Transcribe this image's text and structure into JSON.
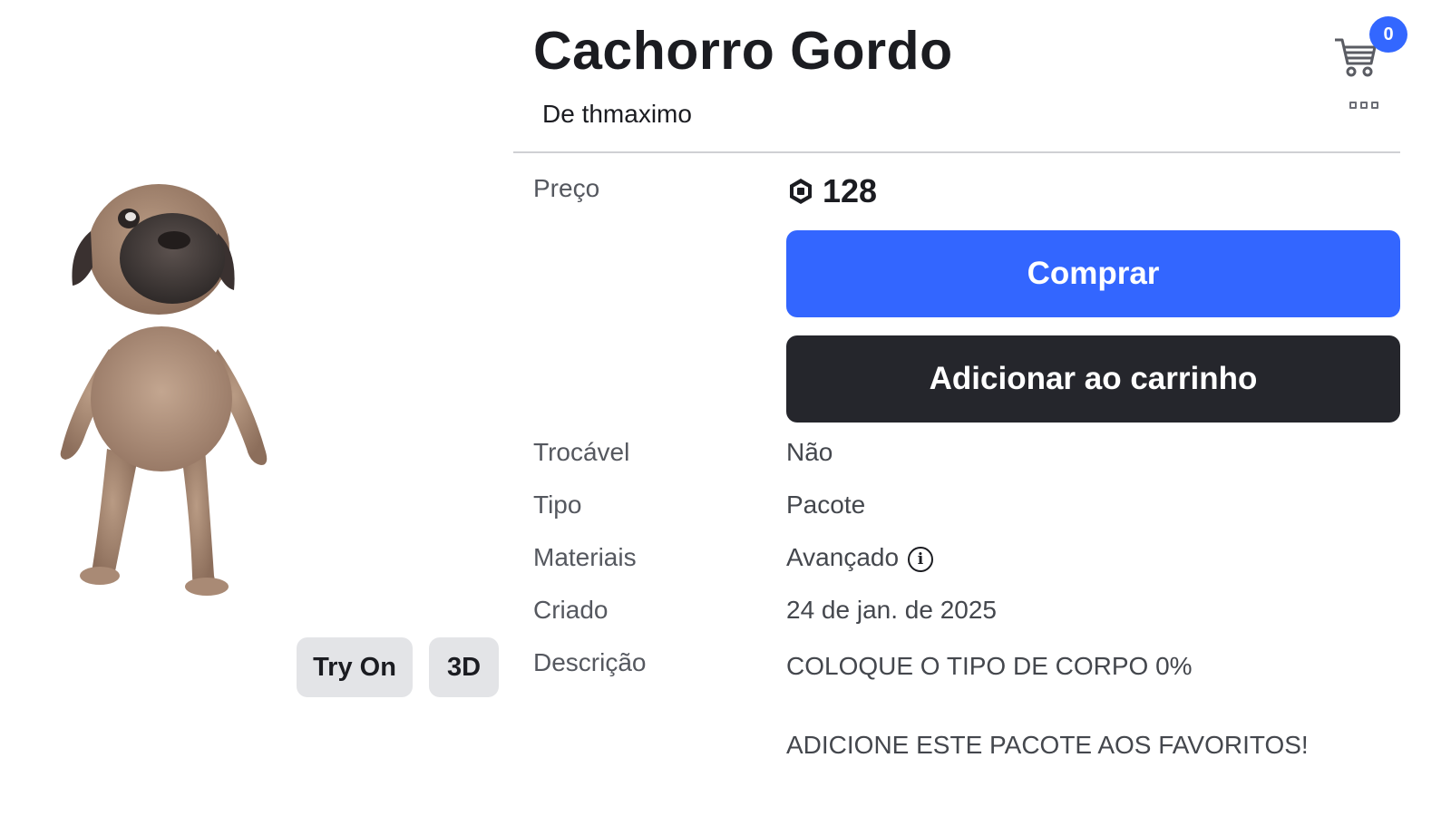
{
  "item": {
    "title": "Cachorro Gordo",
    "creator_text": "De thmaximo"
  },
  "header": {
    "cart_count": "0",
    "cart_icon": "shopping-cart-icon",
    "more_icon": "more-options-icon"
  },
  "preview": {
    "try_on_label": "Try On",
    "view_3d_label": "3D"
  },
  "price": {
    "label": "Preço",
    "currency_icon": "robux-icon",
    "amount": "128"
  },
  "actions": {
    "buy_label": "Comprar",
    "add_to_cart_label": "Adicionar ao carrinho"
  },
  "details": {
    "tradable_label": "Trocável",
    "tradable_value": "Não",
    "type_label": "Tipo",
    "type_value": "Pacote",
    "materials_label": "Materiais",
    "materials_value": "Avançado",
    "materials_info_icon": "info-icon",
    "created_label": "Criado",
    "created_value": "24 de jan. de 2025",
    "description_label": "Descrição",
    "description_line1": "COLOQUE O TIPO DE CORPO 0%",
    "description_line2": "ADICIONE ESTE PACOTE AOS FAVORITOS!"
  },
  "colors": {
    "buy_button": "#3366ff",
    "cart_button": "#25262c",
    "badge": "#3367ff"
  }
}
